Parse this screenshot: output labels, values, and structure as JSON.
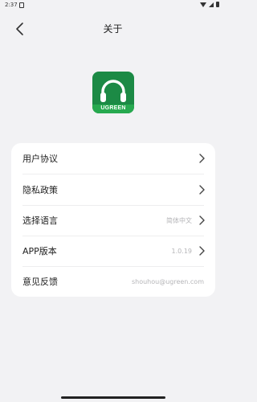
{
  "status": {
    "time": "2:37"
  },
  "header": {
    "title": "关于"
  },
  "logo": {
    "brand": "UGREEN"
  },
  "settings": {
    "rows": [
      {
        "label": "用户协议",
        "value": ""
      },
      {
        "label": "隐私政策",
        "value": ""
      },
      {
        "label": "选择语言",
        "value": "简体中文"
      },
      {
        "label": "APP版本",
        "value": "1.0.19"
      },
      {
        "label": "意见反馈",
        "value": "shouhou@ugreen.com"
      }
    ]
  },
  "colors": {
    "background": "#f2f2f4",
    "brand_green": "#1c8a45",
    "card": "#ffffff",
    "secondary_text": "#b5b5b8"
  },
  "icons": [
    "back-arrow-icon",
    "headphones-icon",
    "chevron-right-icon"
  ]
}
